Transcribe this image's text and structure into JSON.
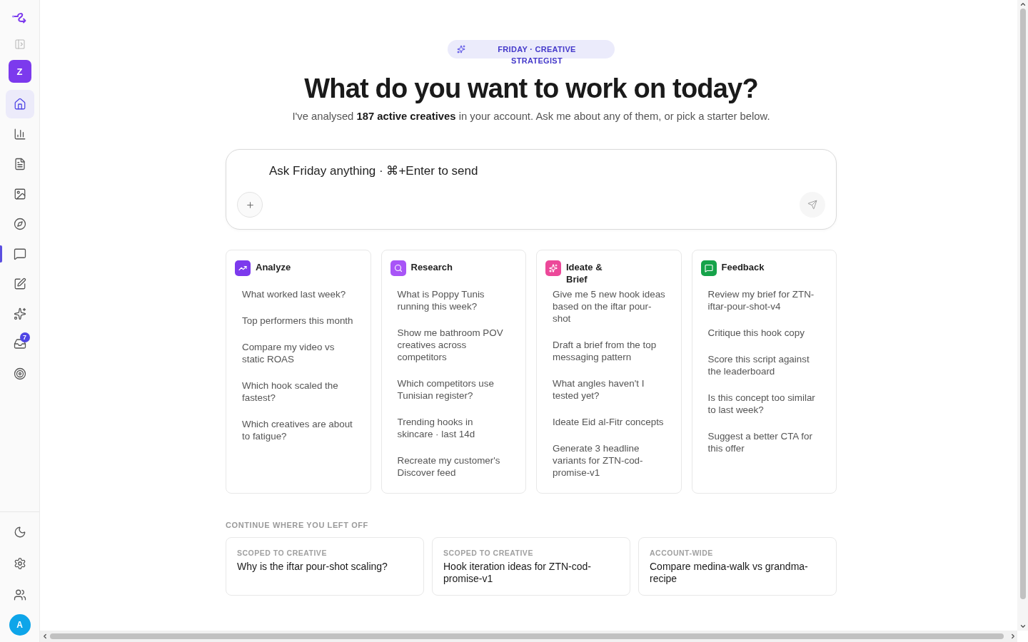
{
  "sidebar": {
    "workspace": "Z",
    "nav": [
      {
        "kind": "home",
        "selected": true,
        "indicator": false
      },
      {
        "kind": "analytics",
        "selected": false,
        "indicator": false
      },
      {
        "kind": "documents",
        "selected": false,
        "indicator": false
      },
      {
        "kind": "media",
        "selected": false,
        "indicator": false
      },
      {
        "kind": "explore",
        "selected": false,
        "indicator": false
      },
      {
        "kind": "chat",
        "selected": false,
        "indicator": true
      },
      {
        "kind": "compose",
        "selected": false,
        "indicator": false
      },
      {
        "kind": "generate",
        "selected": false,
        "indicator": false
      },
      {
        "kind": "inbox",
        "selected": false,
        "indicator": false,
        "badge": "7"
      },
      {
        "kind": "goals",
        "selected": false,
        "indicator": false
      }
    ],
    "user": "A"
  },
  "header": {
    "badge": "FRIDAY · CREATIVE STRATEGIST",
    "title": "What do you want to work on today?",
    "subtitle": "I've analysed **187 active creatives** in your account. Ask me about any of them, or pick a starter below."
  },
  "composer": {
    "placeholder": "Ask Friday anything · ⌘+Enter to send"
  },
  "starters": [
    {
      "kind": "analyze",
      "title": "Analyze",
      "color": "#7c3aed",
      "prompts": [
        "What worked last week?",
        "Top performers this month",
        "Compare my video vs static ROAS",
        "Which hook scaled the fastest?",
        "Which creatives are about to fatigue?"
      ]
    },
    {
      "kind": "research",
      "title": "Research",
      "color": "#a855f7",
      "prompts": [
        "What is Poppy Tunis running this week?",
        "Show me bathroom POV creatives across competitors",
        "Which competitors use Tunisian register?",
        "Trending hooks in skincare · last 14d",
        "Recreate my customer's Discover feed"
      ]
    },
    {
      "kind": "ideate",
      "title": "Ideate & Brief",
      "color": "#ec4899",
      "prompts": [
        "Give me 5 new hook ideas based on the iftar pour-shot",
        "Draft a brief from the top messaging pattern",
        "What angles haven't I tested yet?",
        "Ideate Eid al-Fitr concepts",
        "Generate 3 headline variants for ZTN-cod-promise-v1"
      ]
    },
    {
      "kind": "feedback",
      "title": "Feedback",
      "color": "#16a34a",
      "prompts": [
        "Review my brief for ZTN-iftar-pour-shot-v4",
        "Critique this hook copy",
        "Score this script against the leaderboard",
        "Is this concept too similar to last week?",
        "Suggest a better CTA for this offer"
      ]
    }
  ],
  "continue": {
    "heading": "CONTINUE WHERE YOU LEFT OFF",
    "items": [
      {
        "scope": "SCOPED TO CREATIVE",
        "title": "Why is the iftar pour-shot scaling?"
      },
      {
        "scope": "SCOPED TO CREATIVE",
        "title": "Hook iteration ideas for ZTN-cod-promise-v1"
      },
      {
        "scope": "ACCOUNT-WIDE",
        "title": "Compare medina-walk vs grandma-recipe"
      }
    ]
  }
}
